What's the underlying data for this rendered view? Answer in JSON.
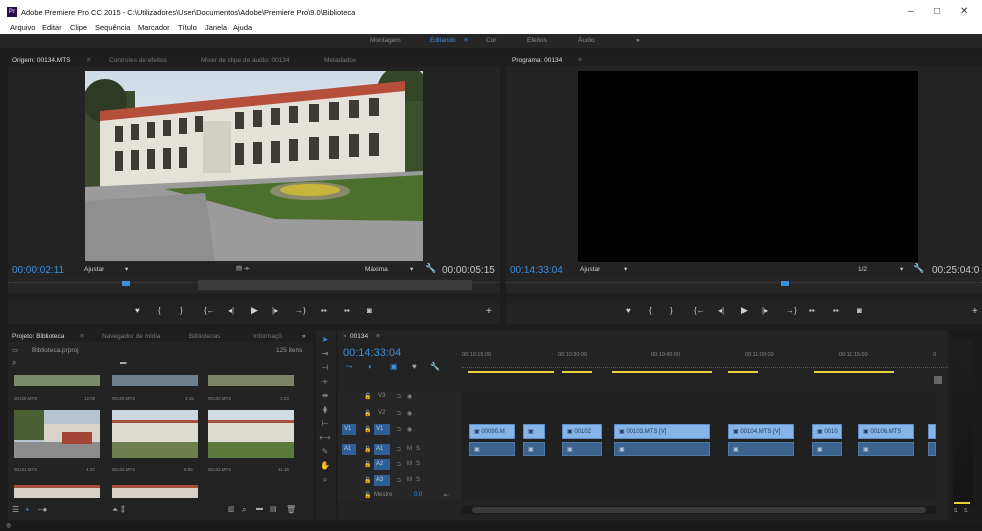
{
  "window": {
    "title": "Adobe Premiere Pro CC 2015 - C:\\Utilizadores\\User\\Documentos\\Adobe\\Premiere Pro\\9.0\\Biblioteca",
    "logo": "Pr",
    "min": "–",
    "max": "□",
    "close": "✕"
  },
  "menu": [
    "Arquivo",
    "Editar",
    "Clipe",
    "Sequência",
    "Marcador",
    "Título",
    "Janela",
    "Ajuda"
  ],
  "workspaces": {
    "items": [
      "Montagem",
      "Editando",
      "Cor",
      "Efeitos",
      "Áudio"
    ],
    "active": "Editando",
    "menu": "≡",
    "more": "»"
  },
  "source": {
    "tabs": [
      "Origem: 00134.MTS",
      "≡",
      "Controles de efeitos",
      "Mixer de clipe de áudio: 00134",
      "Metadados"
    ],
    "timecode_left": "00:00:02:11",
    "fit": "Ajustar",
    "resolution": "Máxima",
    "timecode_right": "00:00:05:15"
  },
  "program": {
    "tabs": [
      "Programa: 00134",
      "≡"
    ],
    "timecode_left": "00:14:33:04",
    "fit": "Ajustar",
    "resolution": "1/2",
    "timecode_right": "00:25:04:0"
  },
  "project": {
    "tabs": [
      "Projeto: Biblioteca",
      "≡",
      "Navegador de mídia",
      "Bibliotecas",
      "Informaçõ",
      "»"
    ],
    "file": "Biblioteca.prproj",
    "count": "125 itens",
    "items": [
      {
        "name": "00128.MTS",
        "dur": "12:06"
      },
      {
        "name": "00129.MTS",
        "dur": "4:15"
      },
      {
        "name": "00130.MTS",
        "dur": "1:23"
      },
      {
        "name": "00131.MTS",
        "dur": "4:20"
      },
      {
        "name": "00132.MTS",
        "dur": "6:06"
      },
      {
        "name": "00133.MTS",
        "dur": "11:15"
      }
    ]
  },
  "timeline": {
    "tab": "00134",
    "tab_close": "×",
    "tab_menu": "≡",
    "timecode": "00:14:33:04",
    "ruler": [
      "00:10:15:00",
      "00:10:30:00",
      "00:10:45:00",
      "00:11:00:00",
      "00:11:15:00",
      "0"
    ],
    "video_tracks": [
      "V3",
      "V2",
      "V1"
    ],
    "audio_tracks": [
      "A1",
      "A2",
      "A3"
    ],
    "src_v": "V1",
    "src_a": "A1",
    "master": "Mestre",
    "master_val": "0.0",
    "m": "M",
    "s": "S",
    "video_clips": [
      "00090.M",
      "",
      "00102",
      "00103.MTS [V]",
      "00104.MTS [V]",
      "0010",
      "00106.MTS",
      ""
    ]
  },
  "meter": {
    "s1": "S",
    "s2": "S"
  },
  "colors": {
    "accent": "#3d8fe0",
    "clip_video": "#86b4e6",
    "clip_audio": "#3b638e",
    "playhead": "#3d8fe0"
  }
}
